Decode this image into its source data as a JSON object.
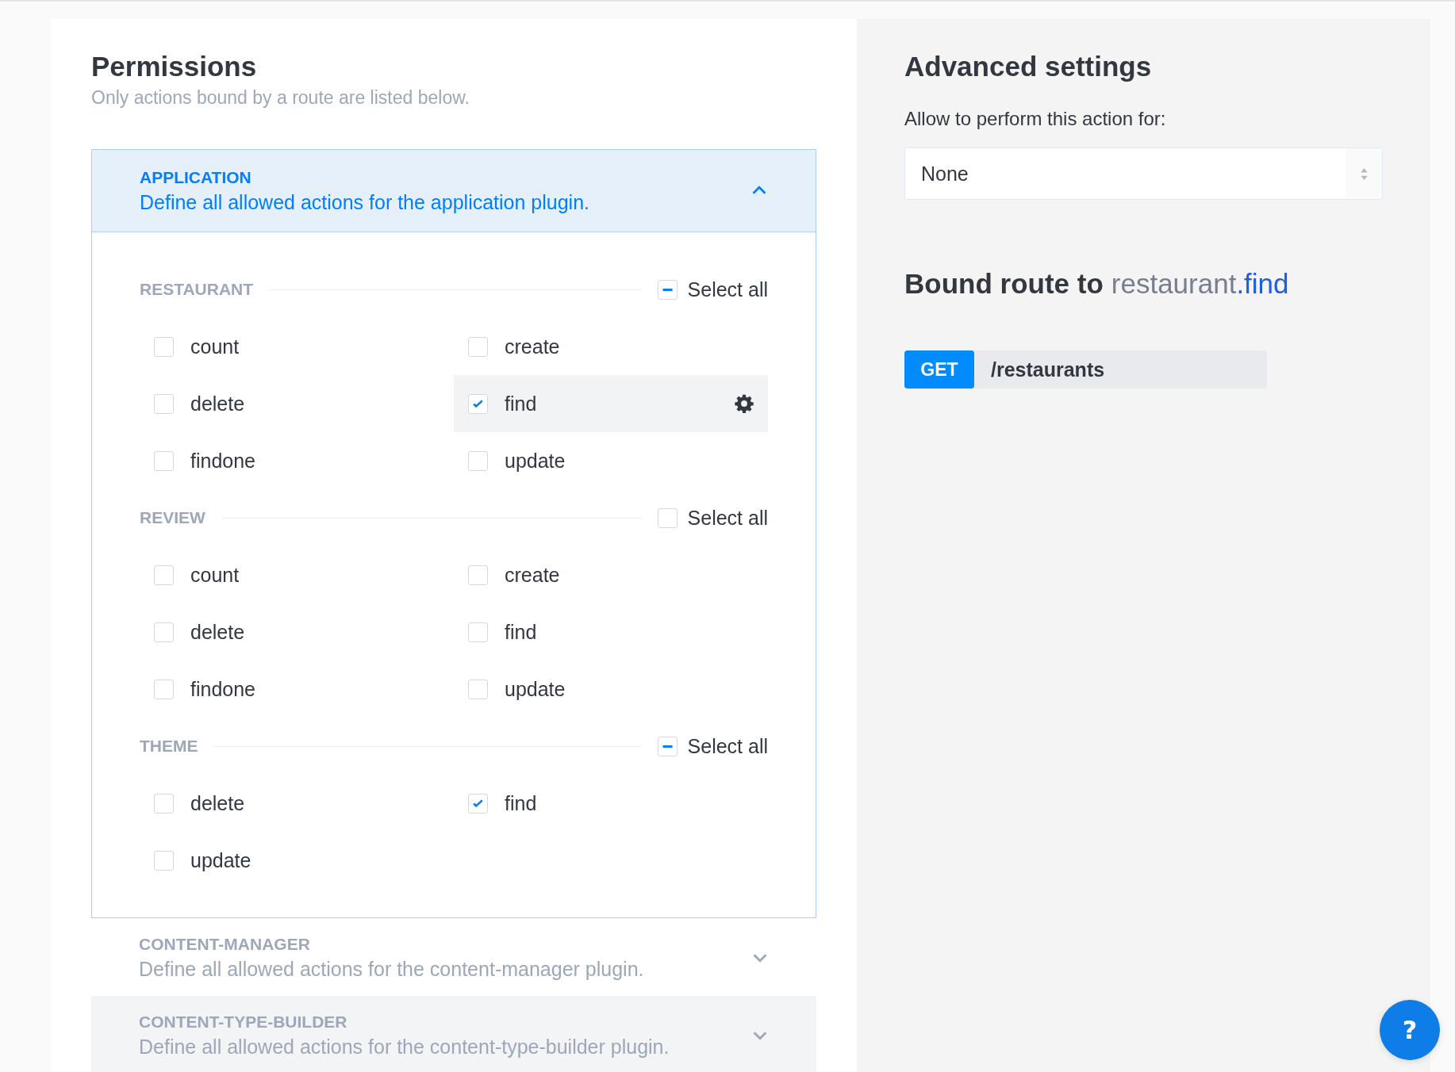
{
  "permissions": {
    "title": "Permissions",
    "subtitle": "Only actions bound by a route are listed below.",
    "sections": [
      {
        "name": "APPLICATION",
        "description": "Define all allowed actions for the application plugin.",
        "expanded": true,
        "hovered": false,
        "groups": [
          {
            "name": "RESTAURANT",
            "select_all": {
              "label": "Select all",
              "indeterminate": true
            },
            "actions": [
              {
                "label": "count",
                "checked": false,
                "selected": false
              },
              {
                "label": "create",
                "checked": false,
                "selected": false
              },
              {
                "label": "delete",
                "checked": false,
                "selected": false
              },
              {
                "label": "find",
                "checked": true,
                "selected": true
              },
              {
                "label": "findone",
                "checked": false,
                "selected": false
              },
              {
                "label": "update",
                "checked": false,
                "selected": false
              }
            ]
          },
          {
            "name": "REVIEW",
            "select_all": {
              "label": "Select all",
              "indeterminate": false
            },
            "actions": [
              {
                "label": "count",
                "checked": false,
                "selected": false
              },
              {
                "label": "create",
                "checked": false,
                "selected": false
              },
              {
                "label": "delete",
                "checked": false,
                "selected": false
              },
              {
                "label": "find",
                "checked": false,
                "selected": false
              },
              {
                "label": "findone",
                "checked": false,
                "selected": false
              },
              {
                "label": "update",
                "checked": false,
                "selected": false
              }
            ]
          },
          {
            "name": "THEME",
            "select_all": {
              "label": "Select all",
              "indeterminate": true
            },
            "actions": [
              {
                "label": "delete",
                "checked": false,
                "selected": false
              },
              {
                "label": "find",
                "checked": true,
                "selected": false
              },
              {
                "label": "update",
                "checked": false,
                "selected": false
              }
            ]
          }
        ]
      },
      {
        "name": "CONTENT-MANAGER",
        "description": "Define all allowed actions for the content-manager plugin.",
        "expanded": false,
        "hovered": false
      },
      {
        "name": "CONTENT-TYPE-BUILDER",
        "description": "Define all allowed actions for the content-type-builder plugin.",
        "expanded": false,
        "hovered": true
      }
    ]
  },
  "advanced": {
    "title": "Advanced settings",
    "policy_label": "Allow to perform this action for:",
    "policy_value": "None",
    "bound_route": {
      "title": "Bound route to",
      "controller": "restaurant",
      "action": ".find",
      "method": "GET",
      "path": "/restaurants"
    }
  },
  "help_button": {
    "label": "?"
  }
}
